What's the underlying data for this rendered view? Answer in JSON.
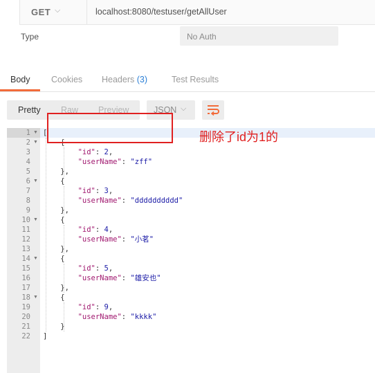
{
  "request": {
    "method": "GET",
    "url": "localhost:8080/testuser/getAllUser"
  },
  "auth": {
    "type_label": "Type",
    "type_value": "No Auth"
  },
  "response_tabs": [
    {
      "label": "Body",
      "active": true
    },
    {
      "label": "Cookies",
      "active": false
    },
    {
      "label": "Headers",
      "count": "(3)",
      "active": false
    },
    {
      "label": "Test Results",
      "active": false
    }
  ],
  "view": {
    "modes": [
      "Pretty",
      "Raw",
      "Preview"
    ],
    "active_mode": "Pretty",
    "format": "JSON",
    "wrap_icon": "wrap-lines-icon"
  },
  "code_lines": [
    {
      "n": "1",
      "fold": true,
      "text": "["
    },
    {
      "n": "2",
      "fold": true,
      "text": "    {"
    },
    {
      "n": "3",
      "fold": false,
      "key": "id",
      "num": "2",
      "text": ""
    },
    {
      "n": "4",
      "fold": false,
      "key": "userName",
      "str": "zff",
      "text": ""
    },
    {
      "n": "5",
      "fold": false,
      "text": "    },"
    },
    {
      "n": "6",
      "fold": true,
      "text": "    {"
    },
    {
      "n": "7",
      "fold": false,
      "key": "id",
      "num": "3",
      "text": ""
    },
    {
      "n": "8",
      "fold": false,
      "key": "userName",
      "str": "dddddddddd",
      "text": ""
    },
    {
      "n": "9",
      "fold": false,
      "text": "    },"
    },
    {
      "n": "10",
      "fold": true,
      "text": "    {"
    },
    {
      "n": "11",
      "fold": false,
      "key": "id",
      "num": "4",
      "text": ""
    },
    {
      "n": "12",
      "fold": false,
      "key": "userName",
      "str": "小茗",
      "text": ""
    },
    {
      "n": "13",
      "fold": false,
      "text": "    },"
    },
    {
      "n": "14",
      "fold": true,
      "text": "    {"
    },
    {
      "n": "15",
      "fold": false,
      "key": "id",
      "num": "5",
      "text": ""
    },
    {
      "n": "16",
      "fold": false,
      "key": "userName",
      "str": "雄安也",
      "text": ""
    },
    {
      "n": "17",
      "fold": false,
      "text": "    },"
    },
    {
      "n": "18",
      "fold": true,
      "text": "    {"
    },
    {
      "n": "19",
      "fold": false,
      "key": "id",
      "num": "9",
      "text": ""
    },
    {
      "n": "20",
      "fold": false,
      "key": "userName",
      "str": "kkkk",
      "text": ""
    },
    {
      "n": "21",
      "fold": false,
      "text": "    }"
    },
    {
      "n": "22",
      "fold": false,
      "text": "]"
    }
  ],
  "annotation": {
    "text": "删除了id为1的",
    "color": "#e02020"
  },
  "colors": {
    "accent": "#f26b3a",
    "key": "#a0186f",
    "value": "#1a1aa6"
  }
}
